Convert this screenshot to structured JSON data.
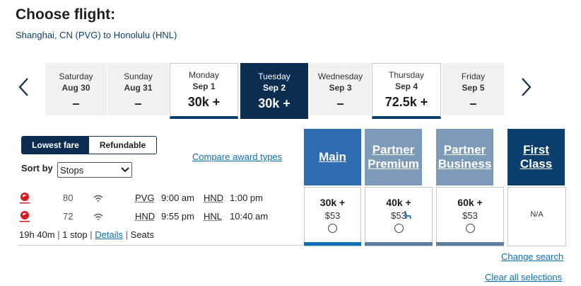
{
  "header": {
    "title": "Choose flight:",
    "route": "Shanghai, CN (PVG) to Honolulu (HNL)"
  },
  "dates": [
    {
      "dow": "Saturday",
      "date": "Aug 30",
      "price": "–",
      "state": "none"
    },
    {
      "dow": "Sunday",
      "date": "Aug 31",
      "price": "–",
      "state": "none"
    },
    {
      "dow": "Monday",
      "date": "Sep 1",
      "price": "30k +",
      "state": "avail"
    },
    {
      "dow": "Tuesday",
      "date": "Sep 2",
      "price": "30k +",
      "state": "selected"
    },
    {
      "dow": "Wednesday",
      "date": "Sep 3",
      "price": "–",
      "state": "none"
    },
    {
      "dow": "Thursday",
      "date": "Sep 4",
      "price": "72.5k +",
      "state": "avail"
    },
    {
      "dow": "Friday",
      "date": "Sep 5",
      "price": "–",
      "state": "none"
    }
  ],
  "fare_toggle": {
    "lowest": "Lowest fare",
    "refundable": "Refundable",
    "active": "lowest"
  },
  "sort": {
    "label": "Sort by",
    "value": "Stops"
  },
  "compare_link": "Compare award types",
  "cabins": [
    {
      "line1": "Main",
      "line2": "",
      "color": "#2f6db3",
      "bar": "#0c6fb5",
      "miles": "30k +",
      "cash": "$53",
      "seat_icon": false
    },
    {
      "line1": "Partner",
      "line2": "Premium",
      "color": "#7d9bb8",
      "bar": "#5d7f9f",
      "miles": "40k +",
      "cash": "$53",
      "seat_icon": true
    },
    {
      "line1": "Partner",
      "line2": "Business",
      "color": "#7d9bb8",
      "bar": "#5d7f9f",
      "miles": "60k +",
      "cash": "$53",
      "seat_icon": false
    },
    {
      "line1": "First",
      "line2": "Class",
      "color": "#0c3f6b",
      "bar": "#0c3f6b",
      "miles": "",
      "cash": "",
      "na": "N/A",
      "seat_icon": false
    }
  ],
  "flight": {
    "segments": [
      {
        "number": "80",
        "from": "PVG",
        "dep": "9:00 am",
        "to": "HND",
        "arr": "1:00 pm"
      },
      {
        "number": "72",
        "from": "HND",
        "dep": "9:55 pm",
        "to": "HNL",
        "arr": "10:40 am"
      }
    ],
    "duration": "19h 40m",
    "stops": "1 stop",
    "details": "Details",
    "seats": "Seats"
  },
  "links": {
    "change_search": "Change search",
    "clear_all": "Clear all selections"
  },
  "colors": {
    "brand_navy": "#0c2d52",
    "link_blue": "#0c6fb5",
    "airline_red": "#d71920"
  }
}
